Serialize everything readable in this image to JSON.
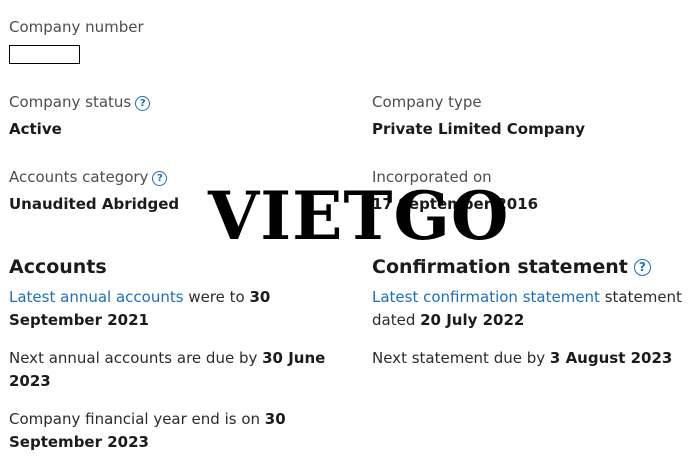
{
  "company_number": {
    "label": "Company number",
    "value": ""
  },
  "company_status": {
    "label": "Company status",
    "value": "Active",
    "help": "?"
  },
  "company_type": {
    "label": "Company type",
    "value": "Private Limited Company"
  },
  "accounts_category": {
    "label": "Accounts category",
    "value": "Unaudited Abridged",
    "help": "?"
  },
  "incorporated": {
    "label": "Incorporated on",
    "value": "17 September 2016"
  },
  "accounts": {
    "heading": "Accounts",
    "latest_link": "Latest annual accounts",
    "latest_text": " were to ",
    "latest_date": "30 September 2021",
    "next_text": "Next annual accounts are due by ",
    "next_date": "30 June 2023",
    "fye_text": "Company financial year end is on ",
    "fye_date": "30 September 2023"
  },
  "confirmation": {
    "heading": "Confirmation statement",
    "help": "?",
    "latest_link": "Latest confirmation statement",
    "latest_text": " statement dated ",
    "latest_date": "20 July 2022",
    "next_text": "Next statement due by ",
    "next_date": "3 August 2023"
  },
  "watermark": {
    "text": "VIETGO"
  }
}
